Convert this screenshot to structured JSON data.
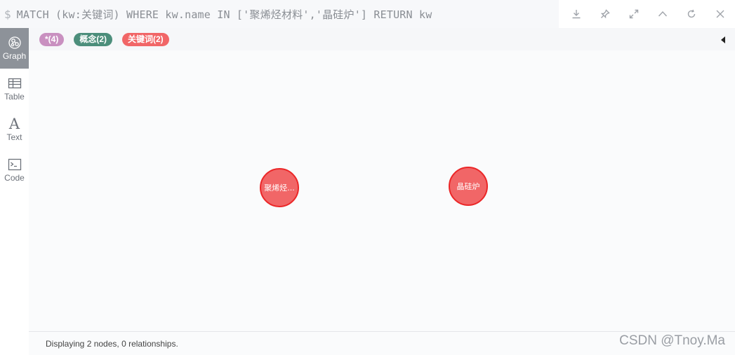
{
  "query": {
    "prompt": "$",
    "text": "MATCH (kw:关键词) WHERE kw.name IN ['聚烯烃材料','晶硅炉'] RETURN kw"
  },
  "toolbar": {
    "icons": [
      "download-icon",
      "pin-icon",
      "expand-icon",
      "collapse-up-icon",
      "rerun-icon",
      "close-icon"
    ]
  },
  "views": [
    {
      "label": "Graph",
      "icon": "graph-icon",
      "active": true
    },
    {
      "label": "Table",
      "icon": "table-icon",
      "active": false
    },
    {
      "label": "Text",
      "icon": "text-icon",
      "active": false
    },
    {
      "label": "Code",
      "icon": "code-icon",
      "active": false
    }
  ],
  "legend": {
    "all": "*(4)",
    "concept": "概念(2)",
    "keyword": "关键词(2)"
  },
  "colors": {
    "all": "#c990c0",
    "concept": "#4c8e7b",
    "keyword": "#f16667",
    "keyword_border": "#eb2728"
  },
  "graph": {
    "nodes": [
      {
        "label": "聚烯烃..."
      },
      {
        "label": "晶硅炉"
      }
    ]
  },
  "status": {
    "text": "Displaying 2 nodes, 0 relationships."
  },
  "watermark": "CSDN @Tnoy.Ma"
}
